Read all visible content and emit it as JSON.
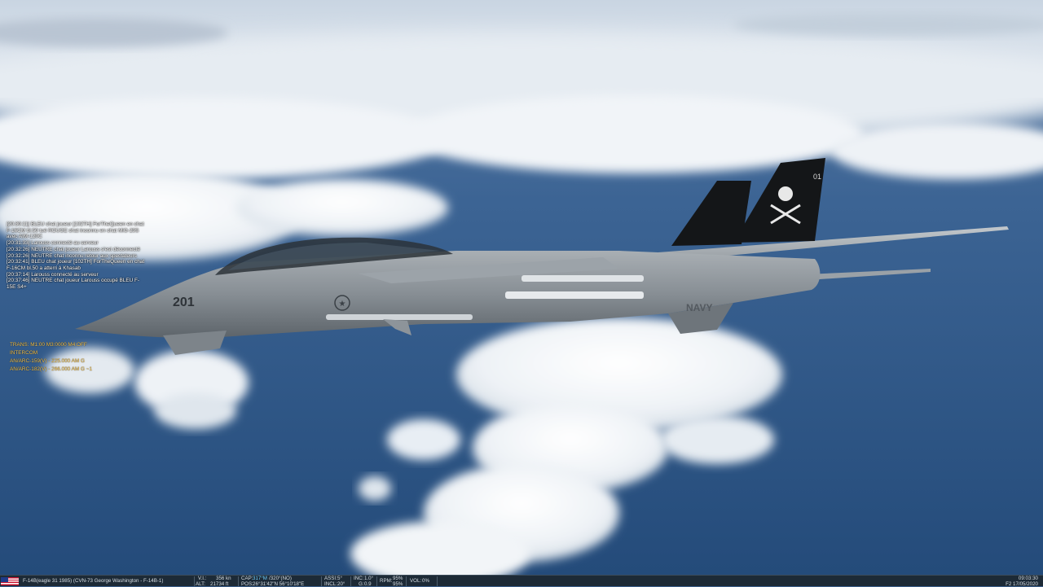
{
  "chat": [
    "[20:30:11] BLEU chat joueur [102TH] ForTheQueen en chat F-16CM bl.50 tué ROUGE chat inconnu en chat MiG-29S avec AIM-120C",
    "[20:31:33] Larouss connecté au serveur",
    "[20:32:26] NEUTRE chat joueur Larouss s'est déconnecté",
    "[20:32:26] NEUTRE chat inconnu retour aux spectateurs",
    "[20:32:41] BLEU chat joueur [102TH] ForTheQueen en chat F-16CM bl.50 a atterri à Khasab",
    "[20:37:14] Larouss connecté au serveur",
    "[20:37:46] NEUTRE chat joueur Larouss occupé BLEU F-15E S4+"
  ],
  "radio": {
    "lines": [
      "TRANS: M1:00 M3:0000 M4:OFF",
      "INTERCOM",
      "AN/ARC-159(V) - 225.000 AM G",
      "AN/ARC-182(V) - 266.000 AM G ~1"
    ]
  },
  "aircraft": {
    "modex": "201",
    "tail_code": "01",
    "service": "NAVY"
  },
  "status": {
    "unit": "F-14B(eagle 31 1985) (CVN-73 George Washington - F-14B-1)",
    "vi_label": "V.I.:",
    "vi_value": "356 kn",
    "alt_label": "ALT:",
    "alt_value": "21734 ft",
    "cap_label": "CAP:",
    "cap_value": "317°M",
    "cap_extra": "/320°(NO)",
    "pos_label": "POS:",
    "pos_value": "26°31'42\"N 56°10'18\"E",
    "assi_label": "ASSI:",
    "assi_value": "5°",
    "incl_label": "INCL:",
    "incl_value": "20°",
    "inc_label": "INC:",
    "inc_value": "1.0°",
    "g_label": "G:",
    "g_value": "0.9",
    "rpm_label": "RPM:",
    "rpm_value1": "95%",
    "rpm_value2": "95%",
    "vol_label": "VOL:",
    "vol_value": "0%",
    "time": "09:03:30",
    "date": "F2 17/05/2020"
  },
  "colors": {
    "radio_active": "#f2c14e",
    "statusbar_bg": "#1d2a36",
    "statusbar_highlight": "#6fd0ff"
  }
}
